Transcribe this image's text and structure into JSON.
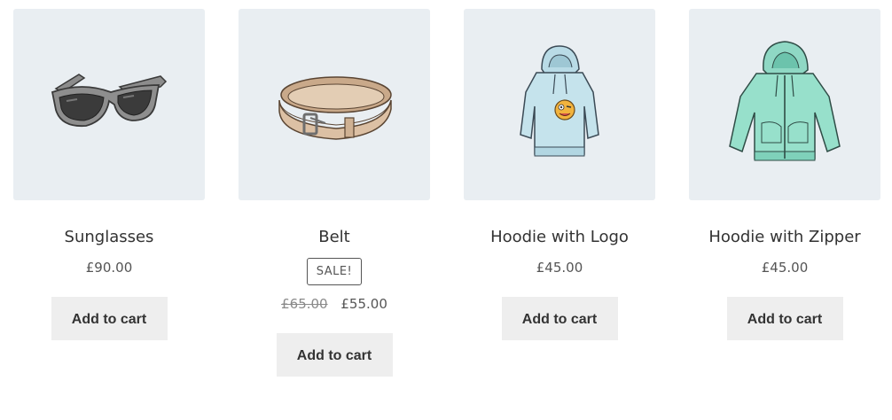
{
  "products": [
    {
      "name": "Sunglasses",
      "price": "£90.00",
      "button_label": "Add to cart",
      "image_icon": "sunglasses-icon"
    },
    {
      "name": "Belt",
      "sale_badge": "SALE!",
      "regular_price": "£65.00",
      "sale_price": "£55.00",
      "button_label": "Add to cart",
      "image_icon": "belt-icon"
    },
    {
      "name": "Hoodie with Logo",
      "price": "£45.00",
      "button_label": "Add to cart",
      "image_icon": "hoodie-logo-icon"
    },
    {
      "name": "Hoodie with Zipper",
      "price": "£45.00",
      "button_label": "Add to cart",
      "image_icon": "hoodie-zipper-icon"
    }
  ],
  "colors": {
    "thumbnail_background": "#e9eef2",
    "button_background": "#eeeeee",
    "text": "#333333",
    "price": "#555555"
  }
}
